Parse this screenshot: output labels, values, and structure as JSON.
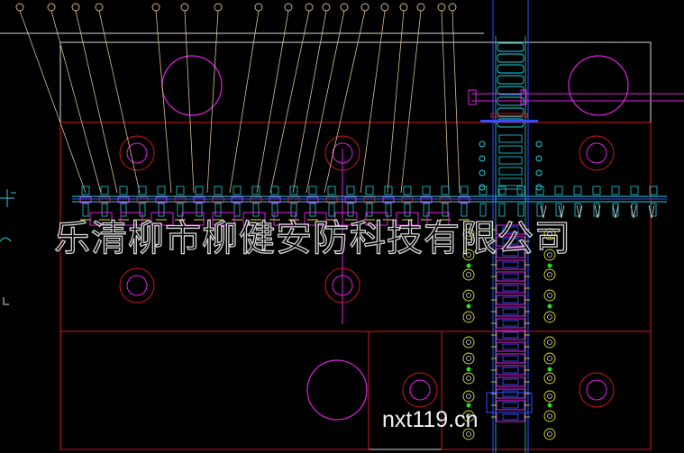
{
  "watermark": {
    "company": "乐清柳市柳健安防科技有限公司",
    "site": "nxt119.cn"
  },
  "colors": {
    "frame_white": "#d9d9d9",
    "plate_red": "#d01818",
    "circle_magenta": "#e020e0",
    "part_cyan": "#20d0e0",
    "part_blue": "#3050ff",
    "part_yellow": "#e0e020",
    "leader_tan": "#d8c090",
    "pin_green": "#20e020"
  },
  "balloons": [
    "",
    "",
    "",
    "",
    "",
    "",
    "",
    "",
    "",
    "",
    "",
    "",
    "",
    "",
    "",
    "",
    "",
    ""
  ]
}
